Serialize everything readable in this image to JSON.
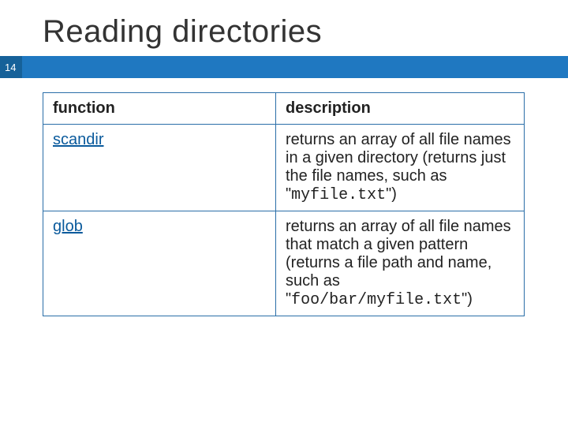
{
  "title": "Reading directories",
  "page_number": "14",
  "table": {
    "headers": {
      "left": "function",
      "right": "description"
    },
    "rows": [
      {
        "func": "scandir",
        "desc_pre": "returns an array of all file names in a given directory\n(returns just the file names, such as \"",
        "desc_code": "myfile.txt",
        "desc_post": "\")"
      },
      {
        "func": "glob",
        "desc_pre": "returns an array of all file names that match a given pattern\n(returns a file path and name, such as \"",
        "desc_code": "foo/bar/myfile.txt",
        "desc_post": "\")"
      }
    ]
  }
}
